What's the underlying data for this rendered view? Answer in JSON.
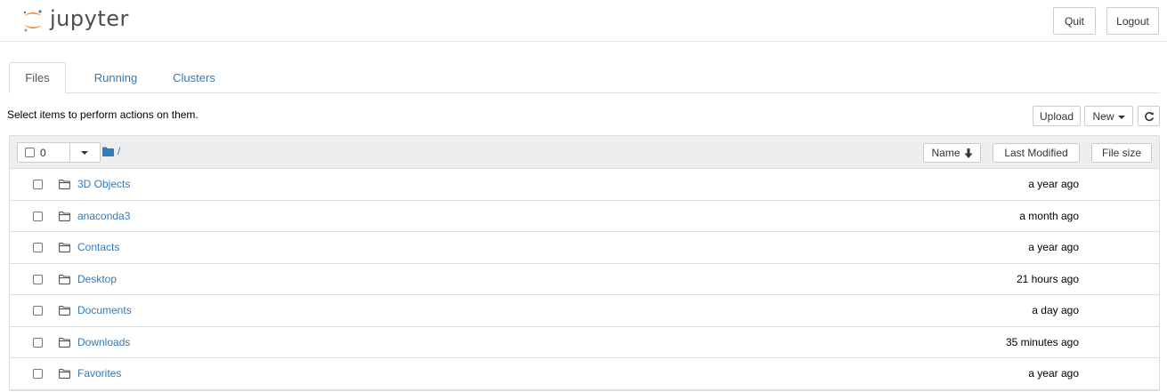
{
  "app": {
    "logo_text": "jupyter"
  },
  "header": {
    "quit_label": "Quit",
    "logout_label": "Logout"
  },
  "tabs": [
    {
      "label": "Files",
      "active": true
    },
    {
      "label": "Running",
      "active": false
    },
    {
      "label": "Clusters",
      "active": false
    }
  ],
  "toolbar": {
    "hint": "Select items to perform actions on them.",
    "upload_label": "Upload",
    "new_label": "New",
    "refresh_icon": "refresh-icon"
  },
  "list_header": {
    "selected_count": "0",
    "path": "/",
    "sort_name_label": "Name",
    "sort_modified_label": "Last Modified",
    "sort_size_label": "File size"
  },
  "items": [
    {
      "name": "3D Objects",
      "modified": "a year ago"
    },
    {
      "name": "anaconda3",
      "modified": "a month ago"
    },
    {
      "name": "Contacts",
      "modified": "a year ago"
    },
    {
      "name": "Desktop",
      "modified": "21 hours ago"
    },
    {
      "name": "Documents",
      "modified": "a day ago"
    },
    {
      "name": "Downloads",
      "modified": "35 minutes ago"
    },
    {
      "name": "Favorites",
      "modified": "a year ago"
    }
  ],
  "colors": {
    "link": "#337ab7",
    "logo_orange": "#f37726",
    "logo_grey": "#767677"
  }
}
